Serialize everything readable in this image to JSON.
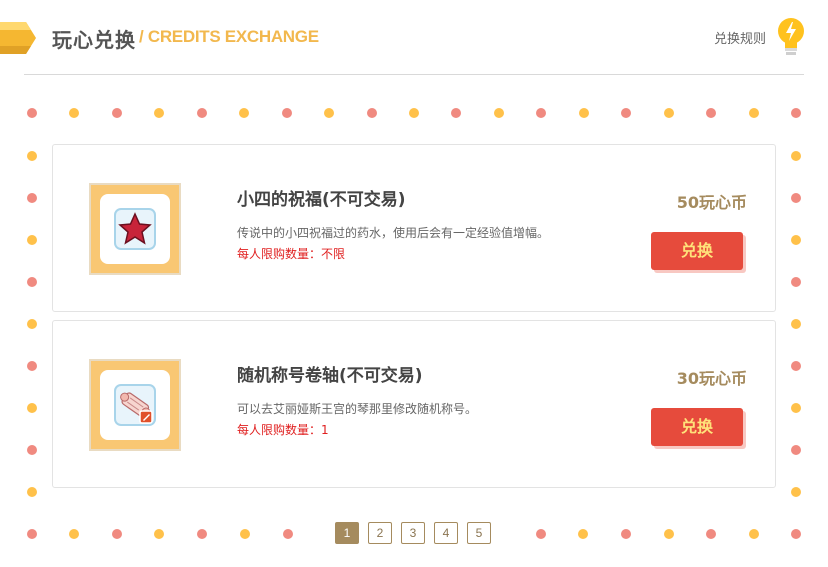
{
  "header": {
    "title": "玩心兑换",
    "subtitle": "/ CREDITS EXCHANGE",
    "rules_link": "兑换规则"
  },
  "items": [
    {
      "name": "小四的祝福(不可交易)",
      "description": "传说中的小四祝福过的药水，使用后会有一定经验值增幅。",
      "limit": "每人限购数量：不限",
      "price": "50玩心币",
      "button": "兑换",
      "icon": "red-star-icon"
    },
    {
      "name": "随机称号卷轴(不可交易)",
      "description": "可以去艾丽娅斯王宫的琴那里修改随机称号。",
      "limit": "每人限购数量：1",
      "price": "30玩心币",
      "button": "兑换",
      "icon": "scroll-icon"
    }
  ],
  "pagination": {
    "pages": [
      "1",
      "2",
      "3",
      "4",
      "5"
    ],
    "current": "1"
  },
  "colors": {
    "accent": "#e64b3c",
    "subtitle": "#f2b84e",
    "price": "#a58b5e",
    "dot_red": "#f08a80",
    "dot_yellow": "#ffc14a"
  }
}
